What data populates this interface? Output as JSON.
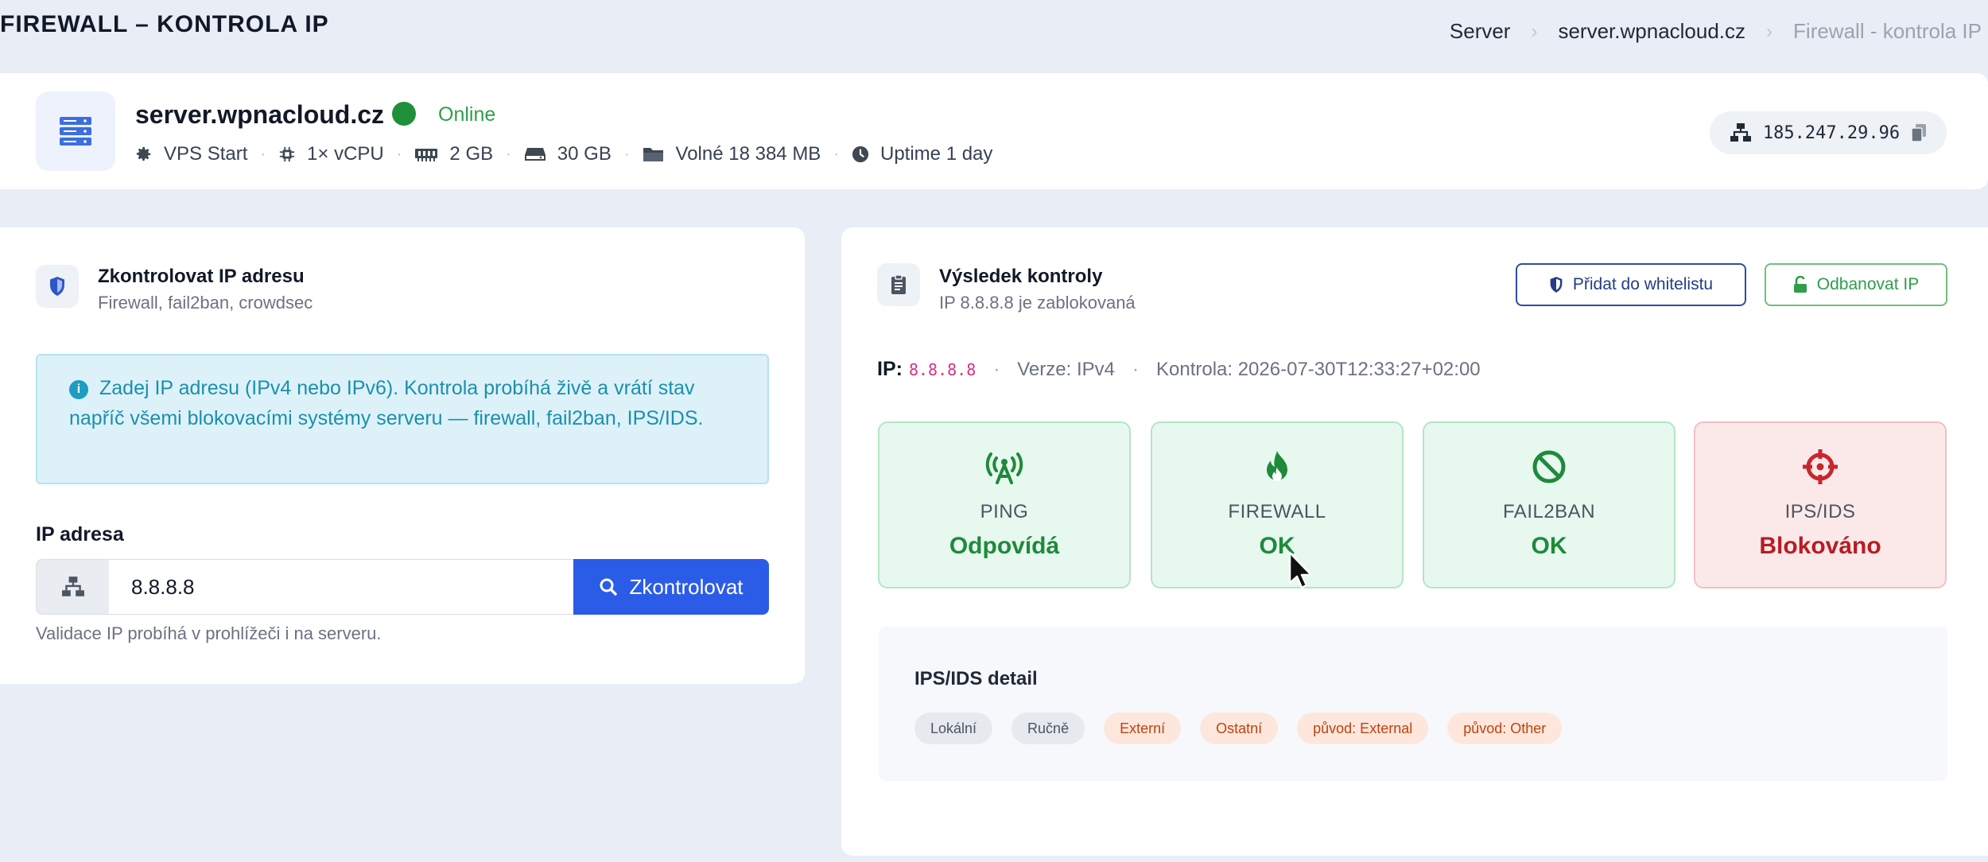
{
  "page": {
    "title": "FIREWALL – KONTROLA IP"
  },
  "breadcrumb": [
    {
      "label": "Server"
    },
    {
      "label": "server.wpnacloud.cz"
    },
    {
      "label": "Firewall - kontrola IP"
    }
  ],
  "server": {
    "icon": "server-icon",
    "name": "server.wpnacloud.cz",
    "status": "Online",
    "status_color": "#1f8f3a",
    "specs": [
      {
        "icon": "gear-icon",
        "label": "VPS Start"
      },
      {
        "icon": "cpu-icon",
        "label": "1× vCPU"
      },
      {
        "icon": "memory-icon",
        "label": "2 GB"
      },
      {
        "icon": "disk-icon",
        "label": "30 GB"
      },
      {
        "icon": "folder-icon",
        "label": "Volné 18 384 MB"
      },
      {
        "icon": "clock-icon",
        "label": "Uptime 1 day"
      }
    ],
    "ip": "185.247.29.96"
  },
  "check_form": {
    "title": "Zkontrolovat IP adresu",
    "subtitle": "Firewall, fail2ban, crowdsec",
    "info": "Zadej IP adresu (IPv4 nebo IPv6). Kontrola probíhá živě a vrátí stav napříč všemi blokovacími systémy serveru — firewall, fail2ban, IPS/IDS.",
    "ip_label": "IP adresa",
    "ip_value": "8.8.8.8",
    "submit_label": "Zkontrolovat",
    "help": "Validace IP probíhá v prohlížeči i na serveru."
  },
  "result": {
    "title": "Výsledek kontroly",
    "subtitle": "IP 8.8.8.8 je zablokovaná",
    "whitelist_label": "Přidat do whitelistu",
    "unban_label": "Odbanovat IP",
    "ip_key": "IP:",
    "ip_value": "8.8.8.8",
    "version": "Verze: IPv4",
    "checked": "Kontrola: 2026-07-30T12:33:27+02:00",
    "tiles": [
      {
        "icon": "antenna-icon",
        "label": "PING",
        "value": "Odpovídá",
        "state": "ok"
      },
      {
        "icon": "fire-icon",
        "label": "FIREWALL",
        "value": "OK",
        "state": "ok"
      },
      {
        "icon": "ban-icon",
        "label": "FAIL2BAN",
        "value": "OK",
        "state": "ok"
      },
      {
        "icon": "crosshairs-icon",
        "label": "IPS/IDS",
        "value": "Blokováno",
        "state": "bad"
      }
    ],
    "detail_title": "IPS/IDS detail",
    "badges": [
      {
        "label": "Lokální",
        "tone": "gray"
      },
      {
        "label": "Ručně",
        "tone": "gray"
      },
      {
        "label": "Externí",
        "tone": "orange"
      },
      {
        "label": "Ostatní",
        "tone": "orange"
      },
      {
        "label": "původ: External",
        "tone": "orange"
      },
      {
        "label": "původ: Other",
        "tone": "orange"
      }
    ]
  },
  "colors": {
    "primary": "#2b5ce8",
    "success": "#1e8a3c",
    "danger": "#b81c24",
    "info": "#1c8fae"
  }
}
